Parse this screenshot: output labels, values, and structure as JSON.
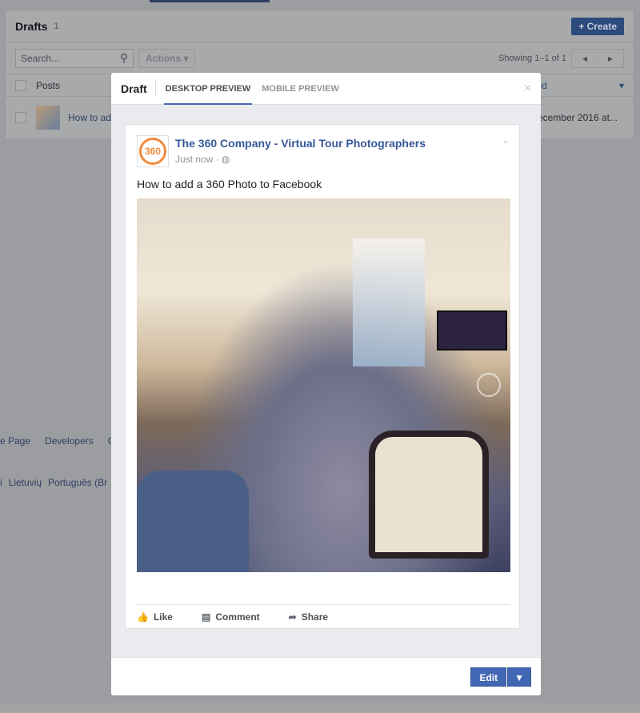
{
  "drafts": {
    "title": "Drafts",
    "count": "1",
    "create_label": "+ Create",
    "search_placeholder": "Search...",
    "actions_label": "Actions ▾",
    "showing": "Showing 1–1 of 1",
    "col_posts": "Posts",
    "col_updated": "Updated",
    "row": {
      "title": "How to add",
      "updated": "ecember 2016 at..."
    }
  },
  "footer": {
    "links1": [
      "e Page",
      "Developers",
      "C"
    ],
    "links2": [
      "i",
      "Lietuvių",
      "Português (Br"
    ]
  },
  "modal": {
    "title": "Draft",
    "tabs": [
      {
        "label": "DESKTOP PREVIEW",
        "active": true
      },
      {
        "label": "MOBILE PREVIEW",
        "active": false
      }
    ],
    "close": "×",
    "post": {
      "logo_text": "360",
      "page_name": "The 360 Company - Virtual Tour Photographers",
      "time": "Just now · ◍",
      "text": "How to add a 360 Photo to Facebook",
      "actions": [
        {
          "icon": "thumbs-up-icon",
          "glyph": "👍",
          "label": "Like"
        },
        {
          "icon": "comment-icon",
          "glyph": "▤",
          "label": "Comment"
        },
        {
          "icon": "share-icon",
          "glyph": "➦",
          "label": "Share"
        }
      ]
    },
    "edit_label": "Edit",
    "edit_menu": "▼"
  },
  "colors": {
    "accent": "#4267b2",
    "link": "#365899",
    "logo": "#f08a3c"
  }
}
